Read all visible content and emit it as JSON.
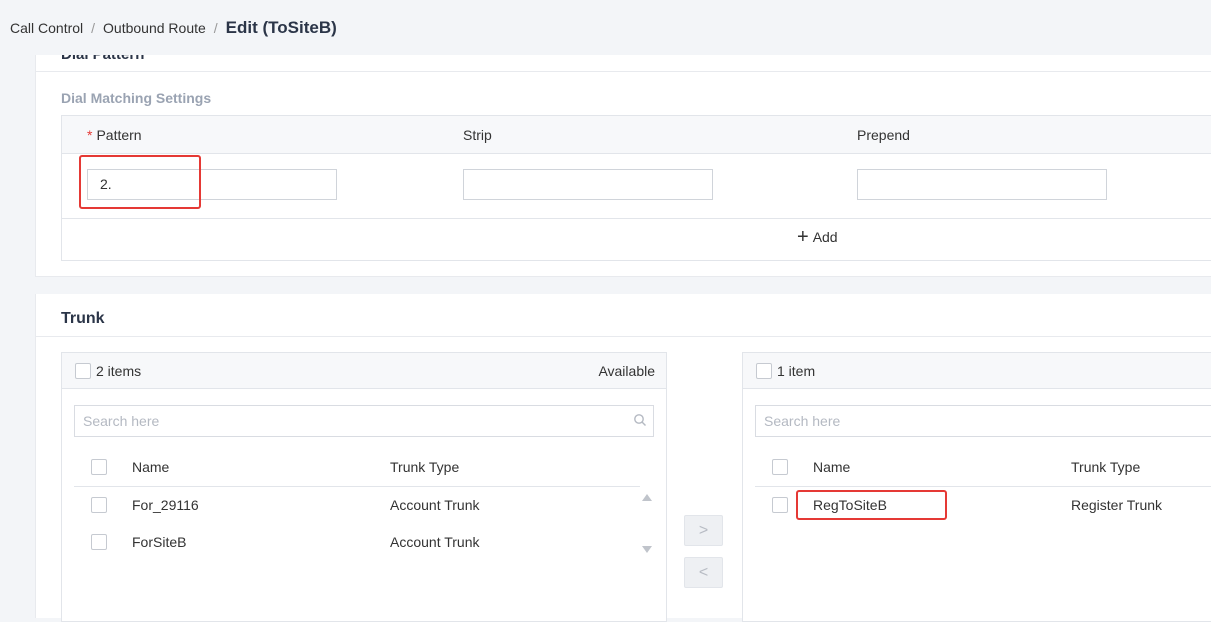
{
  "breadcrumb": {
    "items": [
      "Call Control",
      "Outbound Route"
    ],
    "current": "Edit (ToSiteB)",
    "separator": "/"
  },
  "dial_pattern": {
    "title": "Dial Pattern",
    "subtitle": "Dial Matching Settings",
    "columns": {
      "pattern": "Pattern",
      "strip": "Strip",
      "prepend": "Prepend"
    },
    "required_mark": "*",
    "values": {
      "pattern": "2.",
      "strip": "",
      "prepend": ""
    },
    "add_label": "Add"
  },
  "trunk": {
    "title": "Trunk",
    "available": {
      "count": "2 items",
      "title": "Available",
      "search_placeholder": "Search here",
      "col_name": "Name",
      "col_type": "Trunk Type",
      "rows": [
        {
          "name": "For_29116",
          "type": "Account Trunk"
        },
        {
          "name": "ForSiteB",
          "type": "Account Trunk"
        }
      ]
    },
    "selected": {
      "count": "1 item",
      "search_placeholder": "Search here",
      "col_name": "Name",
      "col_type": "Trunk Type",
      "rows": [
        {
          "name": "RegToSiteB",
          "type": "Register Trunk"
        }
      ]
    },
    "move_right": ">",
    "move_left": "<"
  },
  "colors": {
    "highlight": "#e53935",
    "title": "#2b3548",
    "subtitle": "#9aa3b2"
  }
}
